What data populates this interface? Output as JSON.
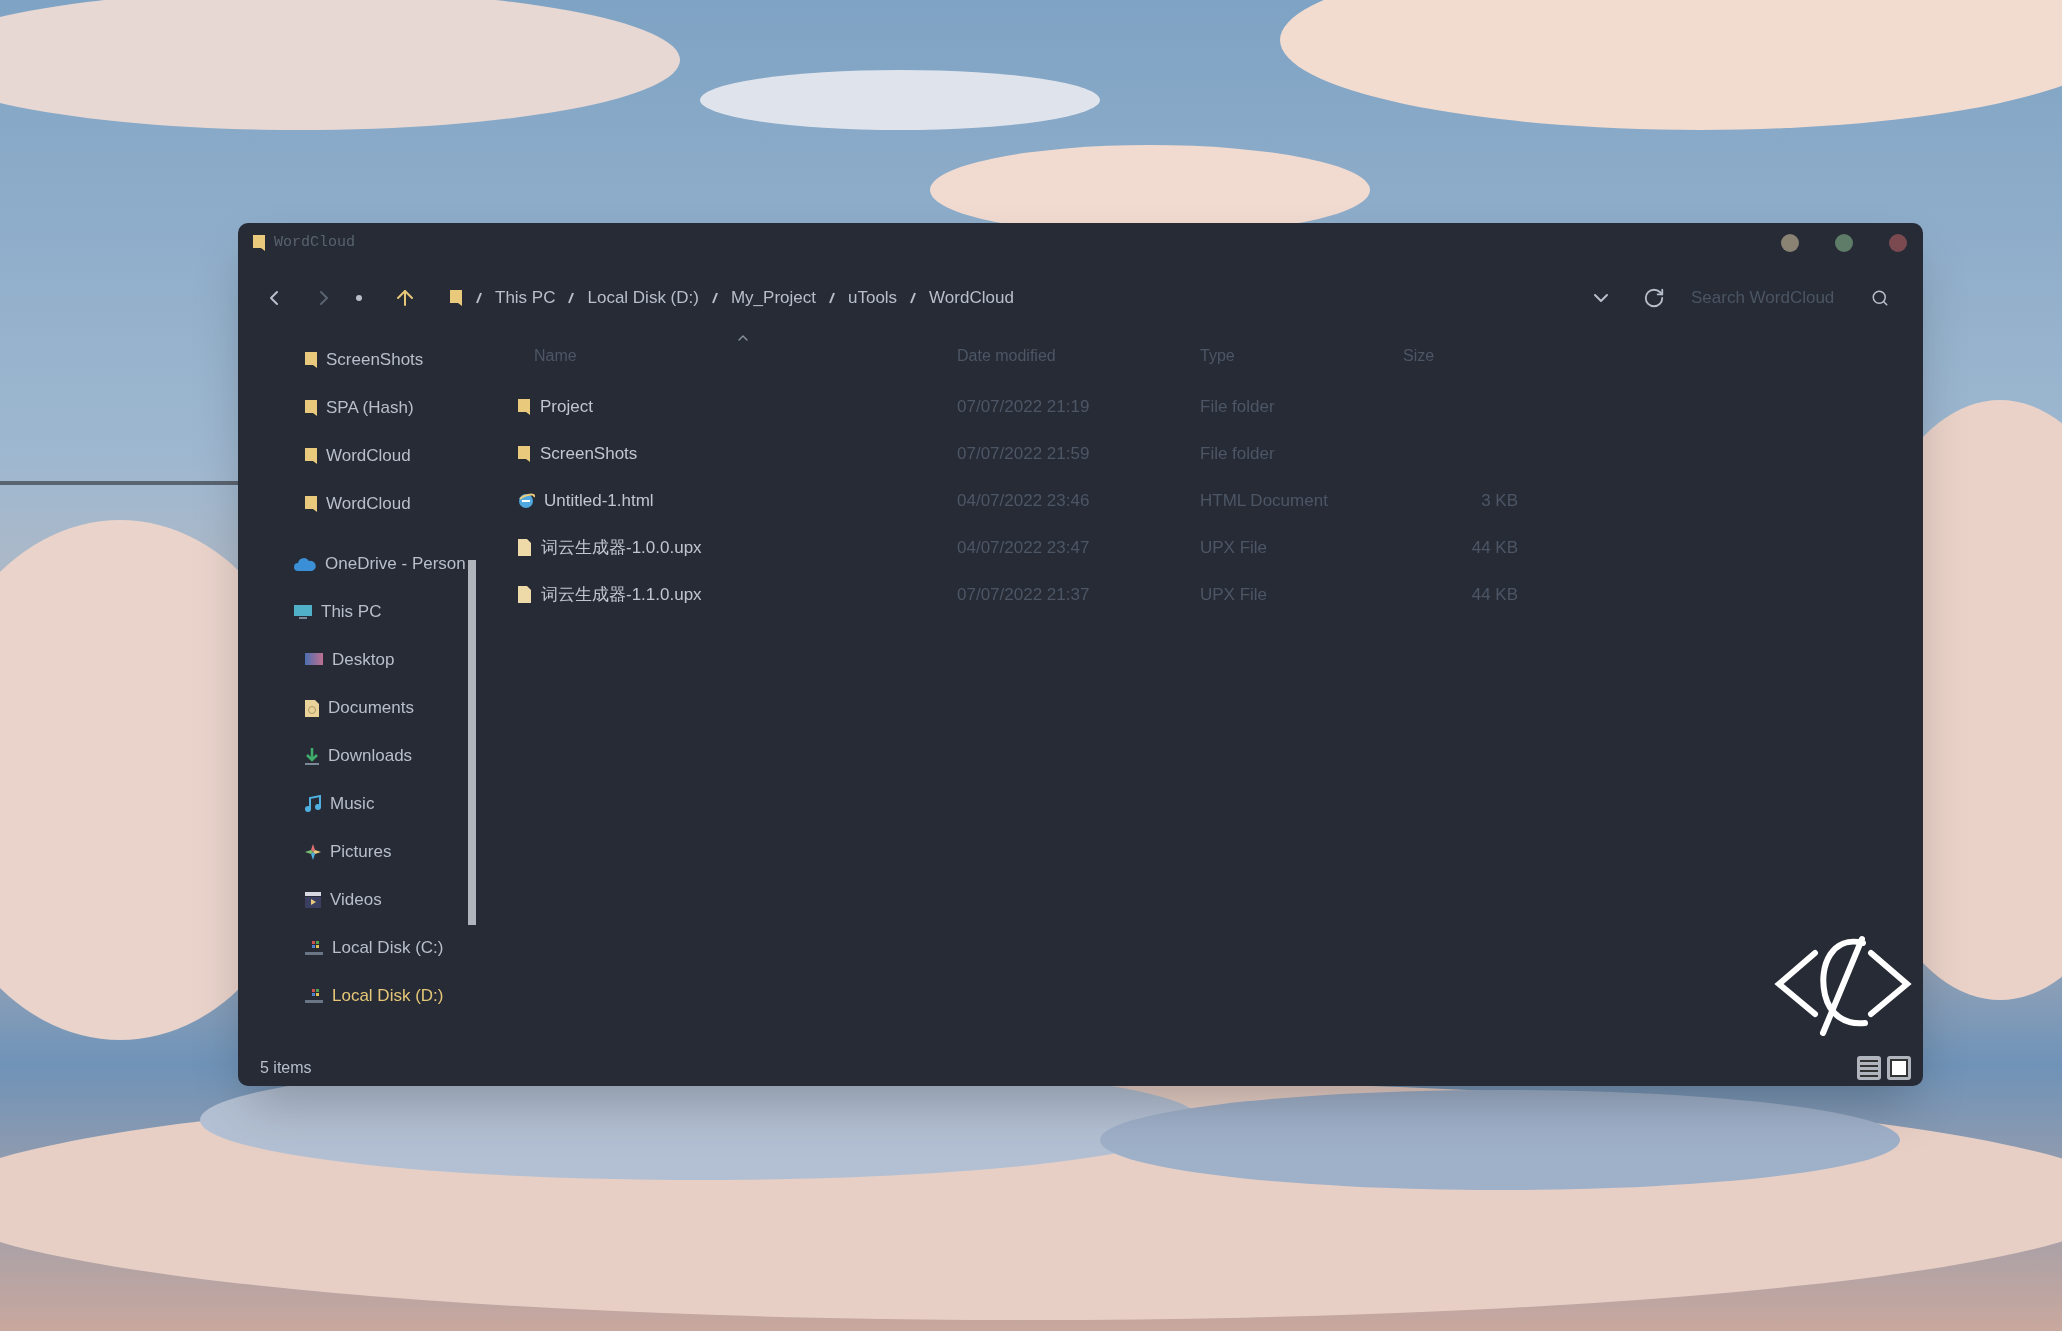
{
  "window": {
    "title": "WordCloud",
    "controls": [
      {
        "color": "#8a8272"
      },
      {
        "color": "#5e7c68"
      },
      {
        "color": "#7a4a50"
      }
    ]
  },
  "toolbar": {
    "breadcrumb": [
      "This PC",
      "Local Disk (D:)",
      "My_Project",
      "uTools",
      "WordCloud"
    ],
    "search": {
      "placeholder": "Search WordCloud"
    }
  },
  "sidebar": {
    "quick_access": [
      {
        "label": "ScreenShots",
        "kind": "folder",
        "selected": false
      },
      {
        "label": "SPA (Hash)",
        "kind": "folder",
        "selected": false
      },
      {
        "label": "WordCloud",
        "kind": "folder",
        "selected": false
      },
      {
        "label": "WordCloud",
        "kind": "folder",
        "selected": false
      }
    ],
    "tree": [
      {
        "label": "OneDrive - Person",
        "kind": "cloud",
        "selected": false
      },
      {
        "label": "This PC",
        "kind": "pc",
        "selected": false,
        "children": [
          {
            "label": "Desktop",
            "kind": "desktop",
            "selected": false
          },
          {
            "label": "Documents",
            "kind": "documents",
            "selected": false
          },
          {
            "label": "Downloads",
            "kind": "downloads",
            "selected": false
          },
          {
            "label": "Music",
            "kind": "music",
            "selected": false
          },
          {
            "label": "Pictures",
            "kind": "pictures",
            "selected": false
          },
          {
            "label": "Videos",
            "kind": "videos",
            "selected": false
          },
          {
            "label": "Local Disk (C:)",
            "kind": "drive",
            "selected": false
          },
          {
            "label": "Local Disk (D:)",
            "kind": "drive",
            "selected": true
          }
        ]
      }
    ]
  },
  "table": {
    "columns": [
      {
        "label": "Name",
        "sorted": true
      },
      {
        "label": "Date modified",
        "sorted": false
      },
      {
        "label": "Type",
        "sorted": false
      },
      {
        "label": "Size",
        "sorted": false
      }
    ],
    "rows": [
      {
        "name": "Project",
        "kind": "folder",
        "date": "07/07/2022 21:19",
        "type": "File folder"
      },
      {
        "name": "ScreenShots",
        "kind": "folder",
        "date": "07/07/2022 21:59",
        "type": "File folder"
      },
      {
        "name": "Untitled-1.html",
        "kind": "html",
        "date": "04/07/2022 23:46",
        "type": "HTML Document",
        "size": "3 KB"
      },
      {
        "name": "词云生成器-1.0.0.upx",
        "kind": "file",
        "date": "04/07/2022 23:47",
        "type": "UPX File",
        "size": "44 KB"
      },
      {
        "name": "词云生成器-1.1.0.upx",
        "kind": "file",
        "date": "07/07/2022 21:37",
        "type": "UPX File",
        "size": "44 KB"
      }
    ]
  },
  "status_bar": {
    "count": "5 items",
    "views": [
      {
        "kind": "details"
      },
      {
        "kind": "large_icons"
      }
    ]
  }
}
